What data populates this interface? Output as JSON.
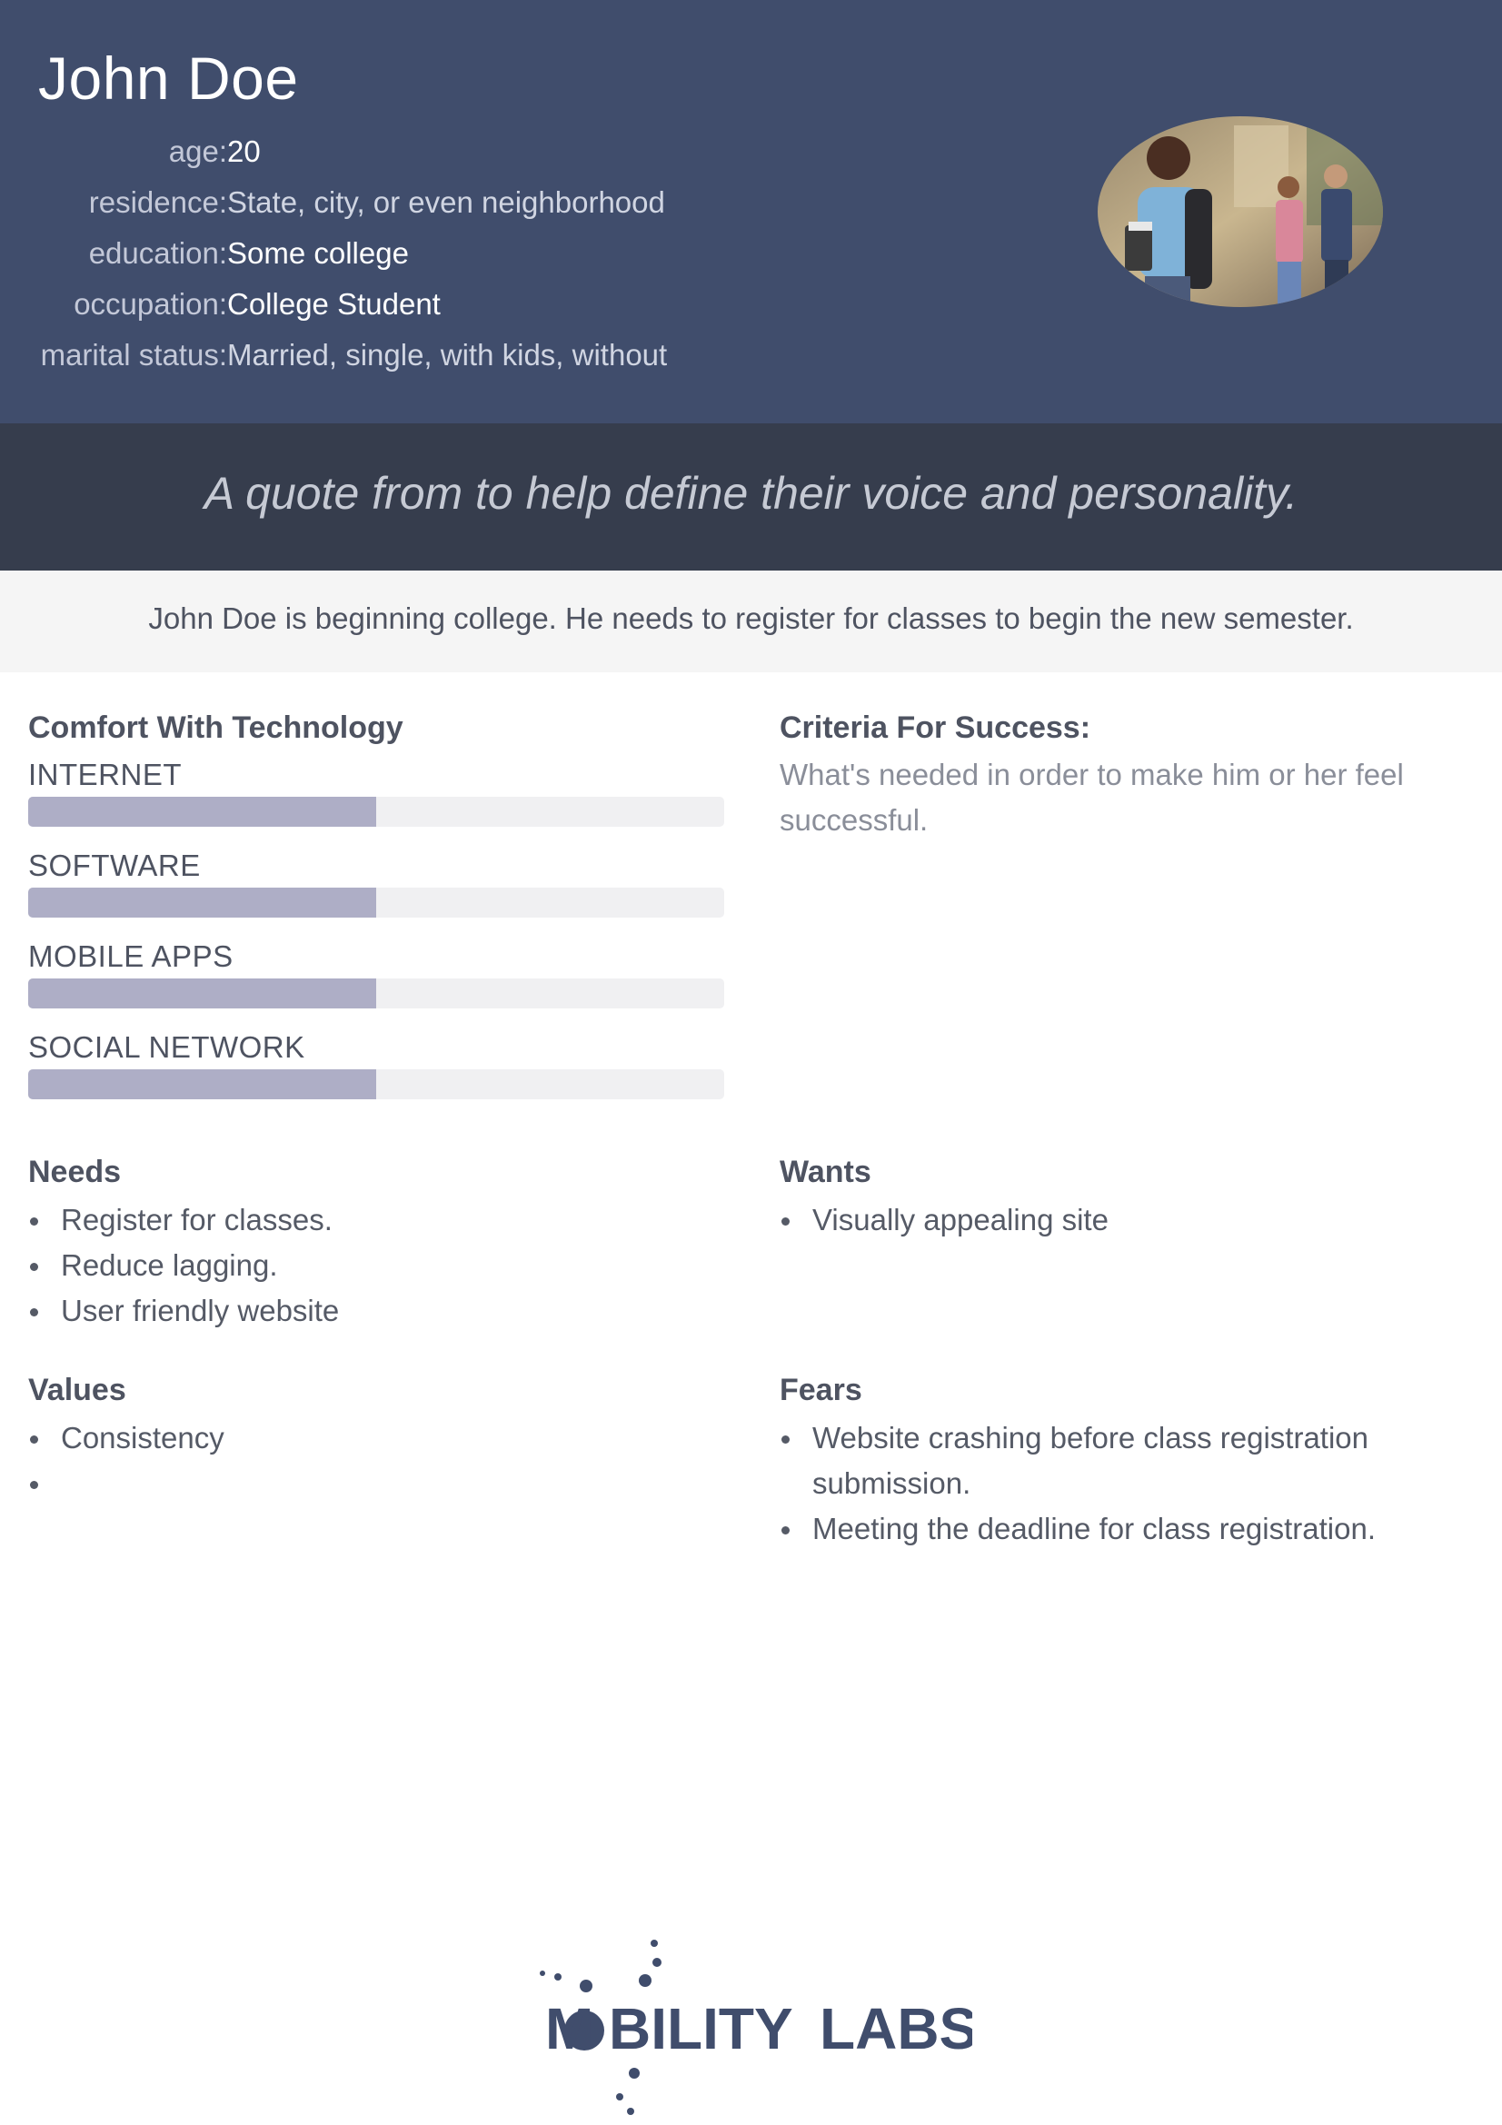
{
  "header": {
    "name": "John Doe",
    "fields": [
      {
        "label": "age:",
        "value": "20"
      },
      {
        "label": "residence:",
        "value": "State, city, or even neighborhood"
      },
      {
        "label": "education:",
        "value": "Some college"
      },
      {
        "label": "occupation:",
        "value": "College Student"
      },
      {
        "label": "marital status:",
        "value": "Married, single, with kids, without"
      }
    ],
    "photo_icon": "persona-photo"
  },
  "quote": "A quote from to help define their voice and personality.",
  "summary": "John Doe is beginning college. He needs to register for classes to begin the new semester.",
  "comfort": {
    "title": "Comfort With Technology",
    "skills": [
      {
        "label": "INTERNET",
        "level": 0.5
      },
      {
        "label": "SOFTWARE",
        "level": 0.5
      },
      {
        "label": "MOBILE APPS",
        "level": 0.5
      },
      {
        "label": "SOCIAL NETWORK",
        "level": 0.5
      }
    ]
  },
  "criteria": {
    "title": "Criteria For Success:",
    "text": "What's needed in order to make him or her feel successful."
  },
  "needs": {
    "title": "Needs",
    "items": [
      "Register for classes.",
      "Reduce lagging.",
      "User friendly website"
    ]
  },
  "wants": {
    "title": "Wants",
    "items": [
      "Visually appealing site"
    ]
  },
  "values": {
    "title": "Values",
    "items": [
      "Consistency",
      ""
    ]
  },
  "fears": {
    "title": "Fears",
    "items": [
      "Website crashing before class registration submission.",
      "Meeting the deadline for class registration."
    ]
  },
  "logo": {
    "text_a": "M",
    "text_b": "BILITY",
    "text_c": "LABS",
    "color": "#404d6c"
  }
}
